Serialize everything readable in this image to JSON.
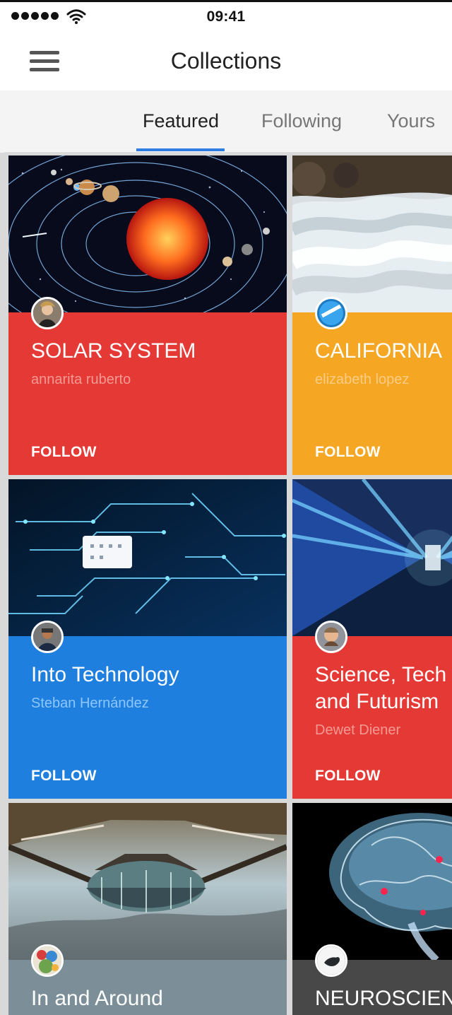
{
  "status_bar": {
    "time": "09:41"
  },
  "app_bar": {
    "title": "Collections"
  },
  "tabs": [
    {
      "label": "Featured",
      "active": true
    },
    {
      "label": "Following",
      "active": false
    },
    {
      "label": "Yours",
      "active": false
    }
  ],
  "collections": [
    {
      "title": "SOLAR SYSTEM",
      "author": "annarita ruberto",
      "follow_label": "FOLLOW",
      "color": "#e53935"
    },
    {
      "title": "CALIFORNIA",
      "author": "elizabeth lopez",
      "follow_label": "FOLLOW",
      "color": "#f5a623"
    },
    {
      "title": "Into Technology",
      "author": "Steban Hernández",
      "follow_label": "FOLLOW",
      "color": "#1f7fde"
    },
    {
      "title": "Science, Tech\nand Futurism",
      "author": "Dewet Diener",
      "follow_label": "FOLLOW",
      "color": "#e53935"
    },
    {
      "title": "In and Around",
      "author": "",
      "follow_label": "",
      "color": "#7c8f98"
    },
    {
      "title": "NEUROSCIEN",
      "author": "",
      "follow_label": "",
      "color": "#484848"
    }
  ]
}
